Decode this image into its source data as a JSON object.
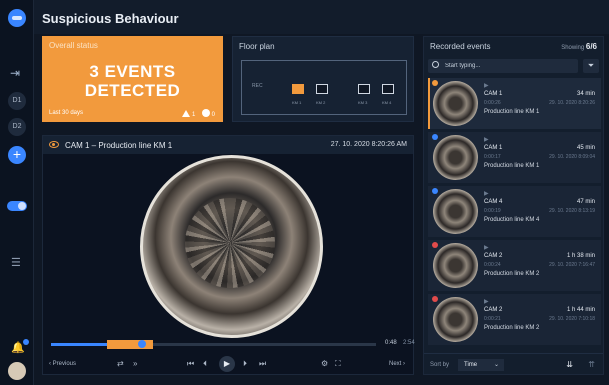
{
  "app": {
    "title": "Suspicious Behaviour"
  },
  "rail": {
    "item1": "D1",
    "item2": "D2",
    "add": "+"
  },
  "status": {
    "label": "Overall status",
    "line1": "3 EVENTS",
    "line2": "DETECTED",
    "period": "Last 30 days",
    "warnings": "1",
    "ok": "0",
    "accent": "#f29a3d"
  },
  "floor": {
    "label": "Floor plan",
    "rec": "REC",
    "cams": [
      "KM 1",
      "KM 2",
      "KM 3",
      "KM 4"
    ]
  },
  "video": {
    "camera": "CAM 1 – Production line KM 1",
    "timestamp": "27. 10. 2020 8:20:26 AM",
    "current": "0:48",
    "total": "2:54",
    "progress": 0.28,
    "prev": "Previous",
    "next": "Next"
  },
  "events": {
    "label": "Recorded events",
    "showing_label": "Showing",
    "showing": "6/6",
    "search_placeholder": "Start typing...",
    "sort_label": "Sort by",
    "sort_value": "Time",
    "items": [
      {
        "cam": "CAM 1",
        "duration": "34 min",
        "code": "0:00:26",
        "date": "29. 10. 2020  8:20:26",
        "line": "Production line KM 1",
        "status_color": "#f29a3d",
        "selected": true
      },
      {
        "cam": "CAM 1",
        "duration": "45 min",
        "code": "0:00:17",
        "date": "29. 10. 2020  8:09:04",
        "line": "Production line KM 1",
        "status_color": "#3a86ff",
        "selected": false
      },
      {
        "cam": "CAM 4",
        "duration": "47 min",
        "code": "0:00:19",
        "date": "29. 10. 2020  8:13:19",
        "line": "Production line KM 4",
        "status_color": "#3a86ff",
        "selected": false
      },
      {
        "cam": "CAM 2",
        "duration": "1 h 38 min",
        "code": "0:00:24",
        "date": "29. 10. 2020  7:16:47",
        "line": "Production line KM 2",
        "status_color": "#e24b4b",
        "selected": false
      },
      {
        "cam": "CAM 2",
        "duration": "1 h 44 min",
        "code": "0:00:21",
        "date": "29. 10. 2020  7:10:18",
        "line": "Production line KM 2",
        "status_color": "#e24b4b",
        "selected": false
      }
    ]
  }
}
